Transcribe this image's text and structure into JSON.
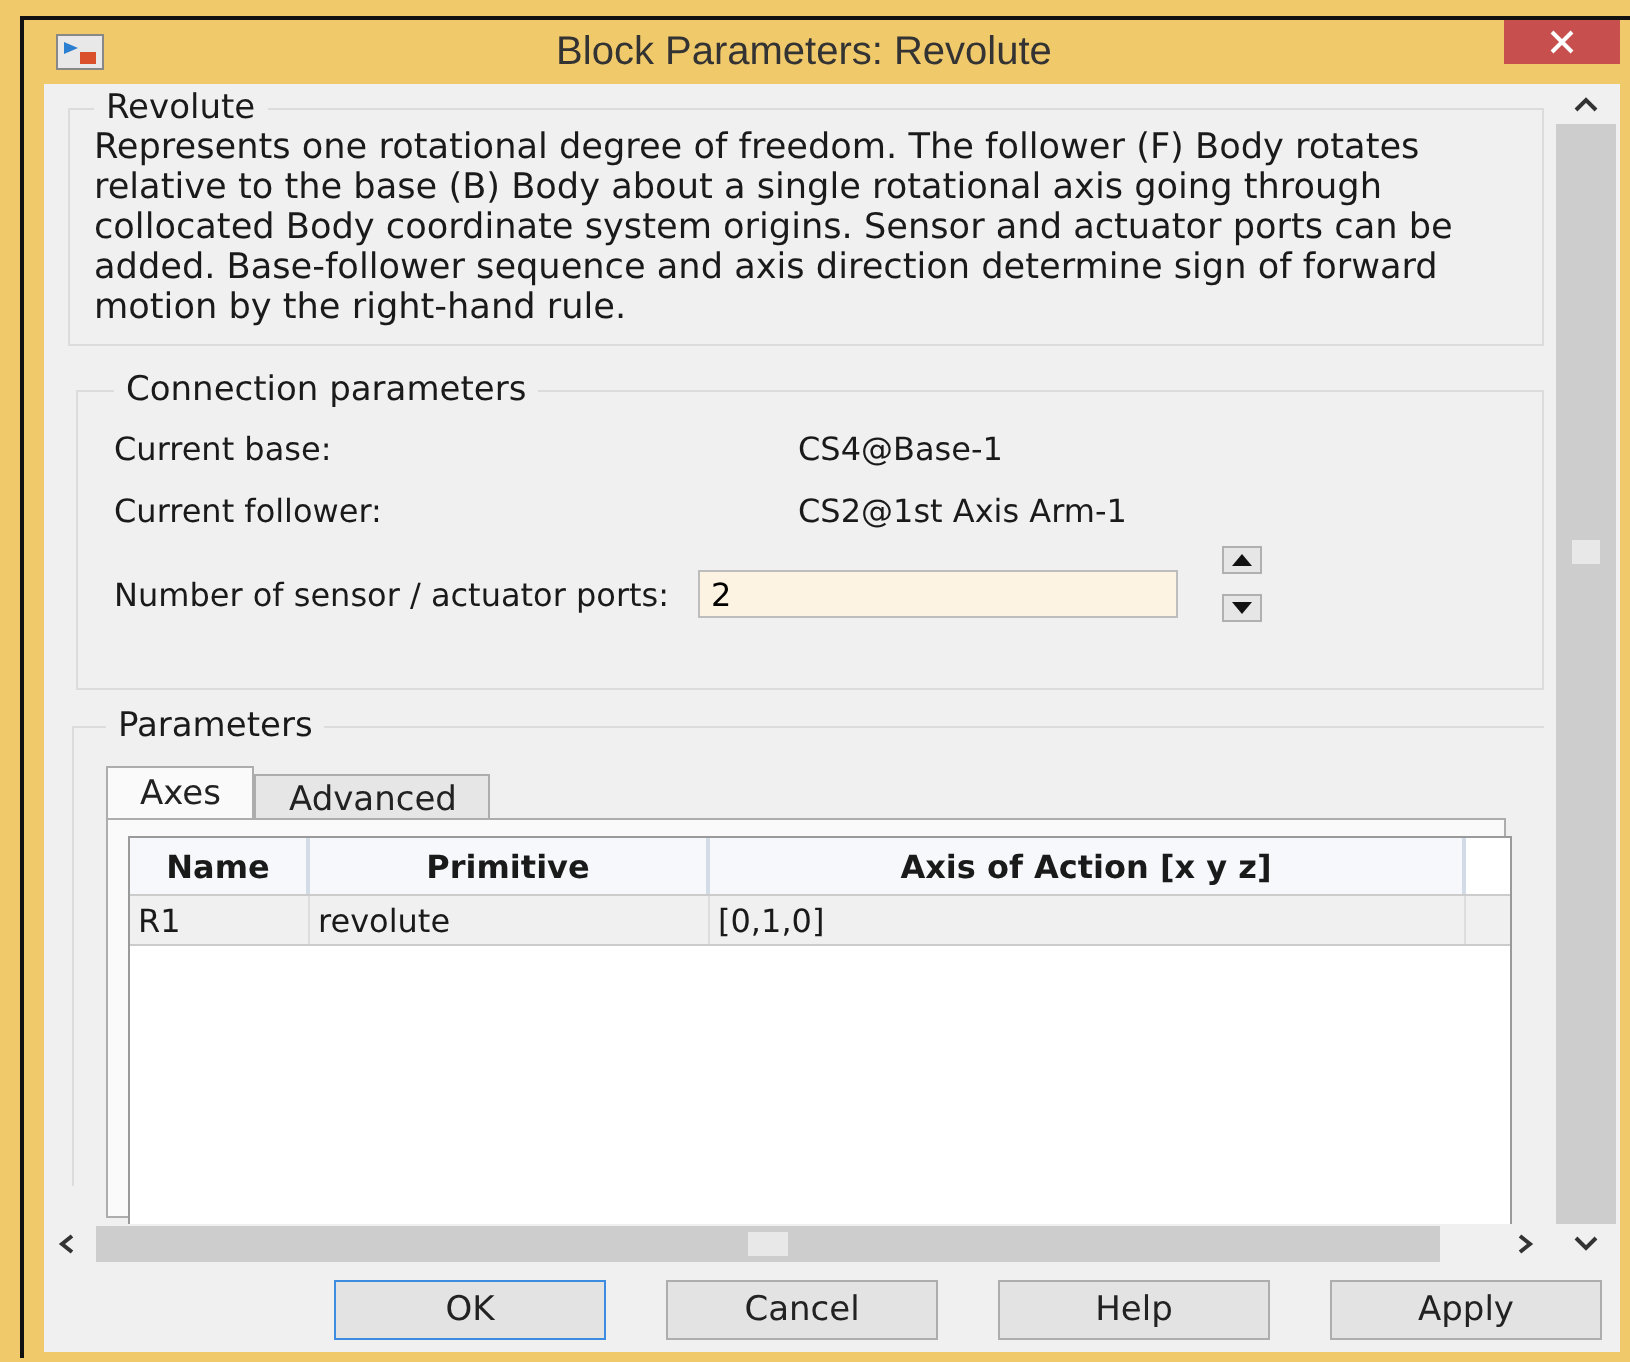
{
  "window": {
    "title": "Block Parameters: Revolute"
  },
  "description": {
    "heading": "Revolute",
    "text": "Represents one rotational degree of freedom. The follower (F) Body rotates relative to the base (B) Body about a single rotational axis going through collocated Body coordinate system origins. Sensor and actuator ports can be added. Base-follower sequence and axis direction determine sign of forward motion by the right-hand rule."
  },
  "connection": {
    "heading": "Connection parameters",
    "rows": [
      {
        "label": "Current base:",
        "value": "CS4@Base-1"
      },
      {
        "label": "Current follower:",
        "value": "CS2@1st Axis Arm-1"
      }
    ],
    "ports": {
      "label": "Number of sensor / actuator ports:",
      "value": "2"
    }
  },
  "parameters": {
    "heading": "Parameters",
    "tabs": [
      {
        "label": "Axes",
        "selected": true
      },
      {
        "label": "Advanced",
        "selected": false
      }
    ],
    "table": {
      "columns": [
        "Name",
        "Primitive",
        "Axis of Action [x y z]"
      ],
      "rows": [
        [
          "R1",
          "revolute",
          "[0,1,0]"
        ]
      ]
    }
  },
  "buttons": [
    {
      "label": "OK",
      "default": true
    },
    {
      "label": "Cancel",
      "default": false
    },
    {
      "label": "Help",
      "default": false
    },
    {
      "label": "Apply",
      "default": false
    }
  ]
}
